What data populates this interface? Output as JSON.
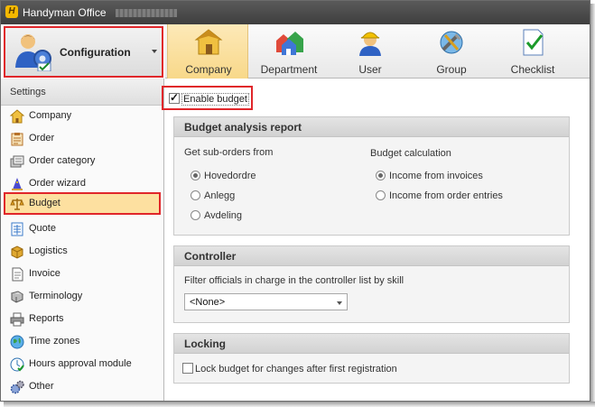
{
  "window": {
    "title": "Handyman Office"
  },
  "config_button": {
    "label": "Configuration"
  },
  "toolbar": {
    "items": [
      {
        "label": "Company",
        "icon": "house-icon",
        "active": true
      },
      {
        "label": "Department",
        "icon": "buildings-icon",
        "active": false
      },
      {
        "label": "User",
        "icon": "worker-icon",
        "active": false
      },
      {
        "label": "Group",
        "icon": "group-tools-icon",
        "active": false
      },
      {
        "label": "Checklist",
        "icon": "checklist-icon",
        "active": false
      }
    ]
  },
  "sidebar": {
    "header": "Settings",
    "items": [
      {
        "label": "Company",
        "icon": "house-icon"
      },
      {
        "label": "Order",
        "icon": "order-icon"
      },
      {
        "label": "Order category",
        "icon": "order-category-icon"
      },
      {
        "label": "Order wizard",
        "icon": "wizard-icon"
      },
      {
        "label": "Budget",
        "icon": "scale-icon",
        "active": true
      },
      {
        "label": "Quote",
        "icon": "quote-icon"
      },
      {
        "label": "Logistics",
        "icon": "box-icon"
      },
      {
        "label": "Invoice",
        "icon": "invoice-icon"
      },
      {
        "label": "Terminology",
        "icon": "dictionary-icon"
      },
      {
        "label": "Reports",
        "icon": "printer-icon"
      },
      {
        "label": "Time zones",
        "icon": "globe-icon"
      },
      {
        "label": "Hours approval module",
        "icon": "approval-icon"
      },
      {
        "label": "Other",
        "icon": "gears-icon"
      }
    ]
  },
  "budget": {
    "enable_label": "Enable budget",
    "enabled": true,
    "analysis": {
      "title": "Budget analysis report",
      "sub_orders_label": "Get sub-orders from",
      "sub_orders_options": [
        "Hovedordre",
        "Anlegg",
        "Avdeling"
      ],
      "sub_orders_selected": "Hovedordre",
      "calc_label": "Budget calculation",
      "calc_options": [
        "Income from invoices",
        "Income from order entries"
      ],
      "calc_selected": "Income from invoices"
    },
    "controller": {
      "title": "Controller",
      "filter_label": "Filter officials in charge in the controller list by skill",
      "select_value": "<None>"
    },
    "locking": {
      "title": "Locking",
      "lock_label": "Lock budget for changes after first registration",
      "locked": false
    }
  },
  "colors": {
    "accent": "#f8d889",
    "highlight": "#e0262a",
    "titlebar": "#4a4a4a"
  }
}
